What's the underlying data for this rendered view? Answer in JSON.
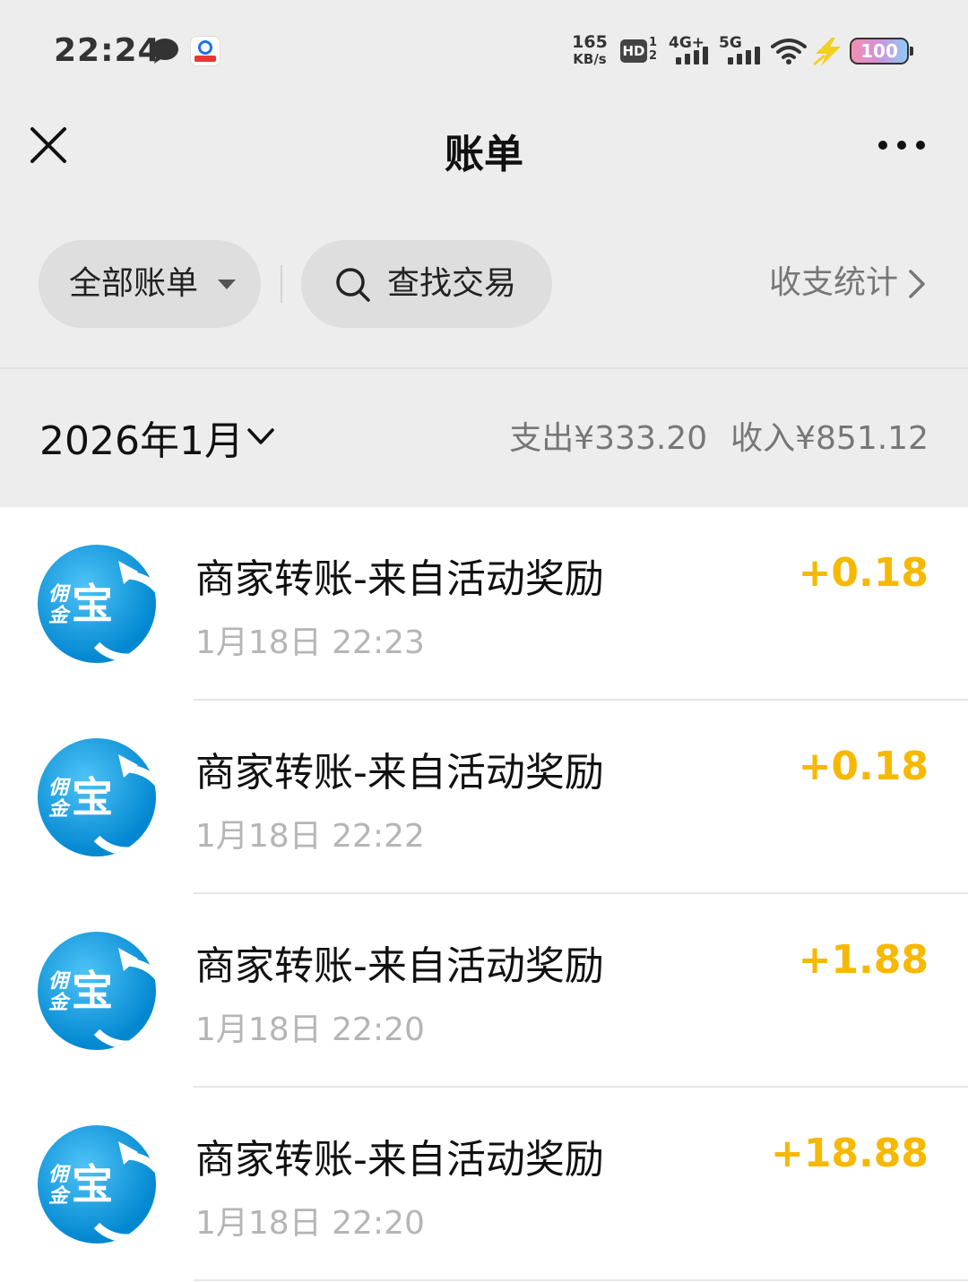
{
  "status_bar": {
    "time": "22:24",
    "speed_value": "165",
    "speed_unit": "KB/s",
    "hd_label": "HD",
    "hd_sub1": "1",
    "hd_sub2": "2",
    "sig1_label": "4G+",
    "sig2_label": "5G",
    "battery": "100",
    "icons": [
      "chat-bubble-icon",
      "telecom-app-icon",
      "hd-icon",
      "signal-4g-icon",
      "signal-5g-icon",
      "wifi-icon",
      "charging-bolt-icon",
      "battery-icon"
    ]
  },
  "nav": {
    "title": "账单",
    "close_icon": "close-icon",
    "more_icon": "more-icon"
  },
  "filters": {
    "all_bills": "全部账单",
    "search": "查找交易",
    "stats": "收支统计"
  },
  "month": {
    "label": "2026年1月",
    "expense": "支出¥333.20",
    "income": "收入¥851.12"
  },
  "transactions": [
    {
      "title": "商家转账-来自活动奖励",
      "time": "1月18日 22:23",
      "amount": "+0.18"
    },
    {
      "title": "商家转账-来自活动奖励",
      "time": "1月18日 22:22",
      "amount": "+0.18"
    },
    {
      "title": "商家转账-来自活动奖励",
      "time": "1月18日 22:20",
      "amount": "+1.88"
    },
    {
      "title": "商家转账-来自活动奖励",
      "time": "1月18日 22:20",
      "amount": "+18.88"
    }
  ],
  "avatar_text": {
    "big": "宝",
    "small_top": "佣",
    "small_bottom": "金"
  },
  "colors": {
    "amount": "#f6b800",
    "background": "#ededed",
    "avatar": "#0288d1"
  }
}
